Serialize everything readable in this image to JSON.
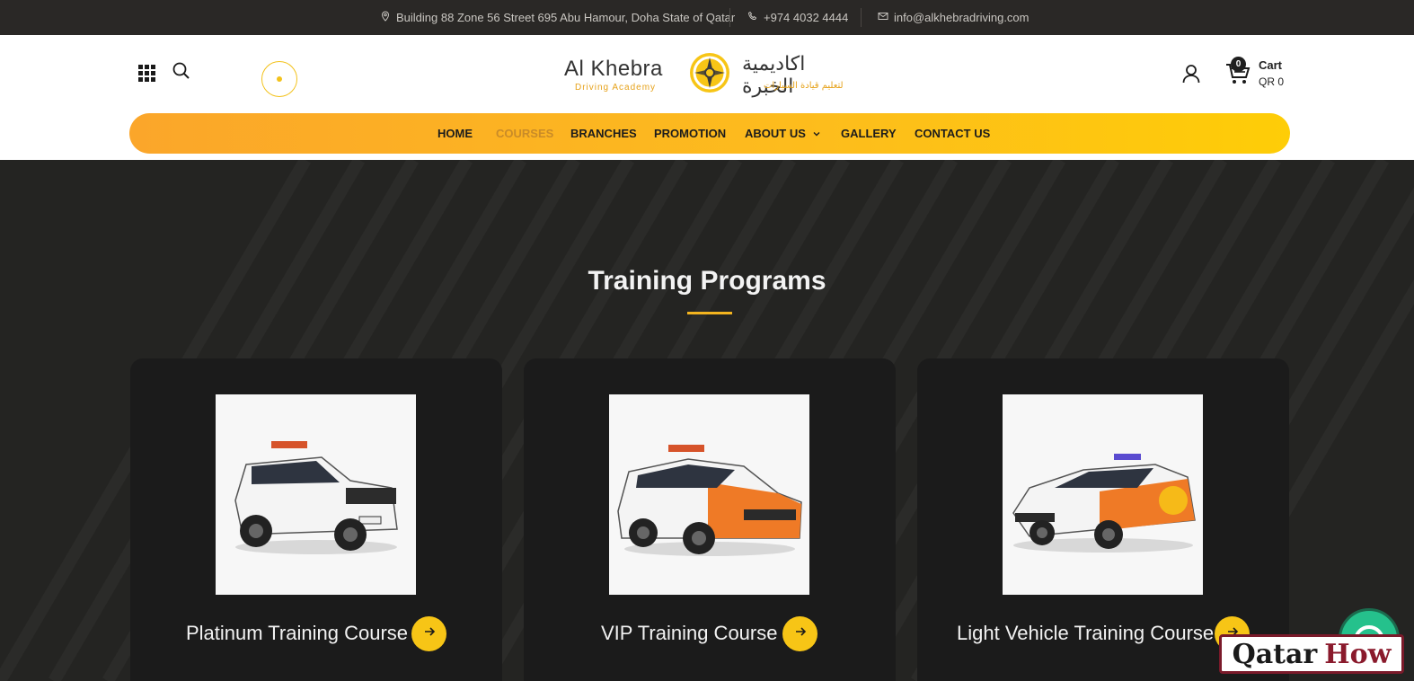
{
  "topbar": {
    "address": "Building 88 Zone 56 Street 695 Abu Hamour, Doha State of Qatar",
    "phone": "+974 4032 4444",
    "email": "info@alkhebradriving.com",
    "icons": {
      "address": "location-pin-icon",
      "phone": "phone-icon",
      "email": "envelope-icon"
    }
  },
  "header": {
    "logo": {
      "en_name": "Al Khebra",
      "en_tagline": "Driving Academy",
      "ar_name": "اكاديمية الخبرة",
      "ar_tagline": "لتعليم قيادة السيارات"
    },
    "cart": {
      "count": "0",
      "label": "Cart",
      "amount": "QR 0"
    }
  },
  "nav": {
    "items": [
      {
        "label": "HOME",
        "active": false
      },
      {
        "label": "COURSES",
        "active": true
      },
      {
        "label": "BRANCHES",
        "active": false
      },
      {
        "label": "PROMOTION",
        "active": false
      },
      {
        "label": "ABOUT US",
        "active": false,
        "dropdown": true
      },
      {
        "label": "GALLERY",
        "active": false
      },
      {
        "label": "CONTACT US",
        "active": false
      }
    ]
  },
  "main": {
    "title": "Training Programs",
    "cards": [
      {
        "label": "Platinum Training Course",
        "vehicle": "white-suv"
      },
      {
        "label": "VIP Training Course",
        "vehicle": "orange-white-crossover"
      },
      {
        "label": "Light Vehicle Training Course",
        "vehicle": "white-orange-sedan"
      }
    ]
  },
  "watermark": {
    "word1": "Qatar",
    "word2": "How"
  },
  "colors": {
    "accent": "#f7c516",
    "nav_start": "#fba62a",
    "nav_end": "#fecd07",
    "active_nav": "#c98b28",
    "dark_bg": "#242422",
    "card_bg": "#1b1b1b",
    "topbar_bg": "#2a2826"
  }
}
